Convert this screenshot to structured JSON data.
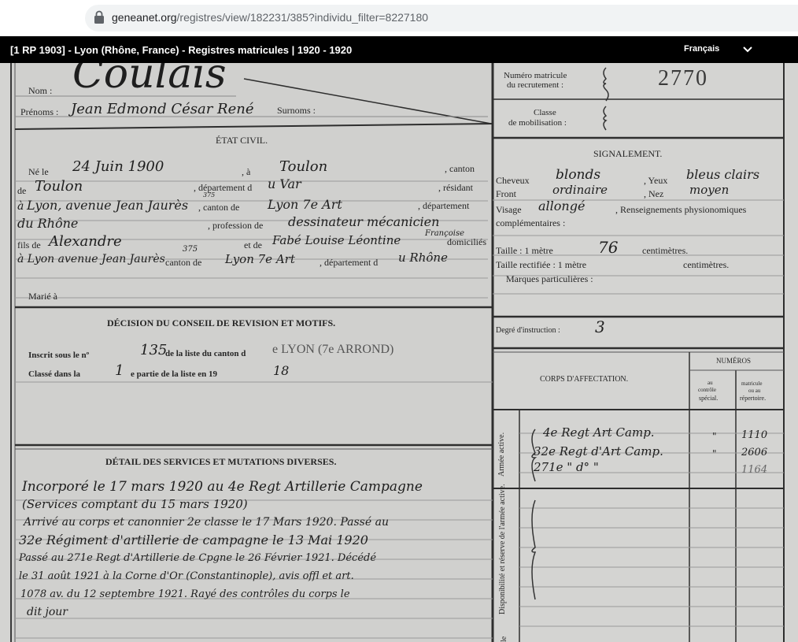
{
  "browser": {
    "url_host": "geneanet.org",
    "url_path": "/registres/view/182231/385?individu_filter=8227180"
  },
  "viewer": {
    "title": "[1 RP 1903] - Lyon (Rhône, France) - Registres matricules | 1920 - 1920",
    "language": "Français"
  },
  "record": {
    "left": {
      "nom_label": "Nom :",
      "nom_value": "Coulais",
      "prenoms_label": "Prénoms :",
      "prenoms_value": "Jean Edmond César René",
      "surnoms_label": "Surnoms :",
      "etat_civil_heading": "ÉTAT CIVIL.",
      "ne_le_label": "Né le",
      "ne_le_value": "24 Juin 1900",
      "a_label": ", à",
      "a_value": "Toulon",
      "canton_label": ", canton",
      "de_label": "de",
      "de_value": "Toulon",
      "departement_label": ", département d",
      "departement_value": "u Var",
      "resident_label": ", résidant",
      "a2_prefix": "à",
      "a2_value": "Lyon, avenue Jean Jaurès",
      "a2_number": "375",
      "canton_de_label": ", canton de",
      "canton_de_value": "Lyon 7e Art",
      "departement2_label": ", département",
      "departement2_value": "du Rhône",
      "profession_label": ", profession de",
      "profession_value": "dessinateur mécanicien",
      "fils_de_label": "fils de",
      "fils_de_value": "Alexandre",
      "et_de_label": "et de",
      "et_de_value": "Fabé Louise Léontine",
      "et_de_extra": "Françoise",
      "domicilies_label": "domiciliés",
      "parents_a_value": "à Lyon avenue Jean Jaurès",
      "parents_number": "375",
      "canton_de2_label": "canton de",
      "canton_de2_value": "Lyon 7e Art",
      "departement3_label": ", département d",
      "departement3_value": "u Rhône",
      "marie_label": "Marié à",
      "decision_heading": "DÉCISION DU CONSEIL DE REVISION ET MOTIFS.",
      "inscrit_label": "Inscrit sous le nº",
      "inscrit_value": "135",
      "liste_canton_label": "de la liste du canton d",
      "liste_canton_value": "e LYON (7e ARROND)",
      "classe_dans_label": "Classé dans la",
      "classe_dans_value": "1",
      "partie_label": "e partie de la liste en 19",
      "partie_year": "18",
      "services_heading": "DÉTAIL DES SERVICES ET MUTATIONS DIVERSES.",
      "services_lines": [
        "Incorporé le 17 mars 1920 au 4e Regt Artillerie Campagne",
        "(Services comptant du 15 mars 1920)",
        "Arrivé au corps et canonnier 2e classe le 17 Mars 1920. Passé au",
        "32e Régiment d'artillerie de campagne le 13 Mai 1920",
        "Passé au 271e Regt d'Artillerie de Cpgne le 26 Février 1921. Décédé",
        "le 31 août 1921 à la Corne d'Or (Constantinople), avis offl et art.",
        "1078 av. du 12 septembre 1921. Rayé des contrôles du corps le",
        "dit jour"
      ]
    },
    "right": {
      "numero_label_1": "Numéro matricule",
      "numero_label_2": "du recrutement :",
      "numero_value": "2770",
      "classe_label_1": "Classe",
      "classe_label_2": "de mobilisation :",
      "signalement_heading": "SIGNALEMENT.",
      "cheveux_label": "Cheveux",
      "cheveux_value": "blonds",
      "yeux_label": ", Yeux",
      "yeux_value": "bleus clairs",
      "front_label": "Front",
      "front_value": "ordinaire",
      "nez_label": ", Nez",
      "nez_value": "moyen",
      "visage_label": "Visage",
      "visage_value": "allongé",
      "renseignements_label": ", Renseignements physionomiques",
      "complementaires_label": "complémentaires :",
      "taille_label": "Taille : 1 mètre",
      "taille_value": "76",
      "centimetres_label": "centimètres.",
      "taille_rectifiee_label": "Taille rectifiée : 1 mètre",
      "centimetres2_label": "centimètres.",
      "marques_label": "Marques particulières :",
      "degre_label": "Degré d'instruction :",
      "degre_value": "3",
      "corps_heading": "CORPS D'AFFECTATION.",
      "numeros_heading": "NUMÉROS",
      "col_controle_1": "au",
      "col_controle_2": "contrôle",
      "col_controle_3": "spécial.",
      "col_matricule_1": "matricule",
      "col_matricule_2": "ou au",
      "col_matricule_3": "répertoire.",
      "armee_active_label": "Armée active.",
      "disponibilite_label": "Disponibilité et réserve de l'armée active.",
      "affectations": [
        {
          "corps": "4e Regt Art Camp.",
          "controle": "\"",
          "matricule": "1110"
        },
        {
          "corps": "32e Regt d'Art Camp.",
          "controle": "\"",
          "matricule": "2606"
        },
        {
          "corps": "271e \" d° \"",
          "controle": "",
          "matricule": "1164"
        }
      ],
      "bottom_cut_label": "le"
    }
  }
}
